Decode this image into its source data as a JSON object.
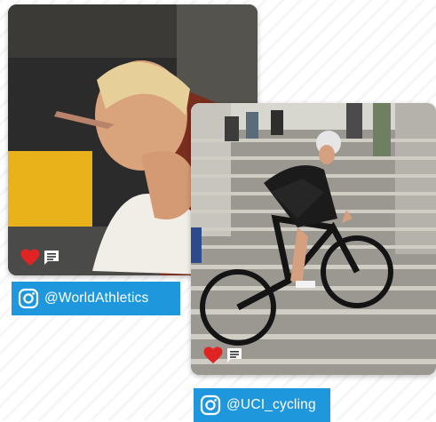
{
  "posts": [
    {
      "handle": "@WorldAthletics",
      "platform_icon": "instagram-icon",
      "like_icon": "heart-icon",
      "comment_icon": "comment-icon"
    },
    {
      "handle": "@UCI_cycling",
      "platform_icon": "instagram-icon",
      "like_icon": "heart-icon",
      "comment_icon": "comment-icon"
    }
  ],
  "colors": {
    "tag_background": "#1f97dc",
    "heart": "#e02424",
    "text": "#ffffff"
  }
}
